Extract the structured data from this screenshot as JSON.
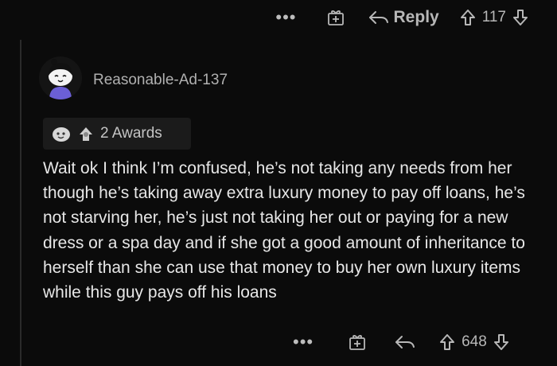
{
  "top_bar": {
    "more_label": "•••",
    "reply_label": "Reply",
    "vote_count": "117",
    "icons": [
      "more-icon",
      "award-icon",
      "reply-icon",
      "upvote-icon",
      "downvote-icon"
    ]
  },
  "comment": {
    "username": "Reasonable-Ad-137",
    "awards_label": "2 Awards",
    "body": "Wait ok I think I’m confused, he’s not taking any needs from her though he’s taking away extra luxury money to pay off loans, he’s not starving her, he’s just not taking her out or paying for a new dress or a spa day and if she got a good amount of inheritance to herself than she can use that money to buy her own luxury items while this guy pays off his loans"
  },
  "bottom_bar": {
    "more_label": "•••",
    "vote_count": "648",
    "icons": [
      "more-icon",
      "award-icon",
      "reply-icon",
      "upvote-icon",
      "downvote-icon"
    ]
  },
  "colors": {
    "background": "#0b0b0b",
    "text": "#e7e7e7",
    "muted": "#b7b7b7",
    "award_pill": "#1b1b1b",
    "avatar_shirt": "#6b5fd6"
  }
}
